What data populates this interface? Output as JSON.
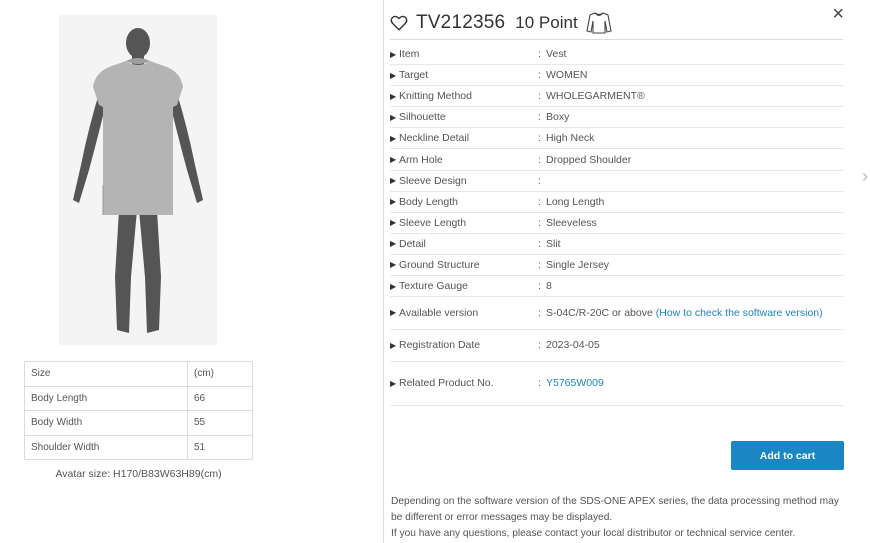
{
  "product": {
    "code": "TV212356",
    "points": "10 Point"
  },
  "specs": [
    {
      "label": "Item",
      "value": "Vest"
    },
    {
      "label": "Target",
      "value": "WOMEN"
    },
    {
      "label": "Knitting Method",
      "value": "WHOLEGARMENT®"
    },
    {
      "label": "Silhouette",
      "value": "Boxy"
    },
    {
      "label": "Neckline Detail",
      "value": "High Neck"
    },
    {
      "label": "Arm Hole",
      "value": "Dropped Shoulder"
    },
    {
      "label": "Sleeve Design",
      "value": ""
    },
    {
      "label": "Body Length",
      "value": "Long Length"
    },
    {
      "label": "Sleeve Length",
      "value": "Sleeveless"
    },
    {
      "label": "Detail",
      "value": "Slit"
    },
    {
      "label": "Ground Structure",
      "value": "Single Jersey"
    },
    {
      "label": "Texture Gauge",
      "value": "8"
    }
  ],
  "available_version": {
    "label": "Available version",
    "value": "S-04C/R-20C or above",
    "link": "(How to check the software version)"
  },
  "registration": {
    "label": "Registration Date",
    "value": "2023-04-05"
  },
  "related": {
    "label": "Related Product No.",
    "value": "Y5765W009"
  },
  "colon": ":",
  "cart_label": "Add to cart",
  "note_lines": [
    "Depending on the software version of the SDS-ONE APEX series, the data processing method may",
    "be different or error messages may be displayed.",
    "If you have any questions, please contact your local distributor or technical service center."
  ],
  "size_table": {
    "header": [
      "Size",
      "(cm)"
    ],
    "rows": [
      [
        "Body Length",
        "66"
      ],
      [
        "Body Width",
        "55"
      ],
      [
        "Shoulder Width",
        "51"
      ]
    ]
  },
  "avatar_size": "Avatar size: H170/B83W63H89(cm)",
  "icons": {
    "close": "×",
    "next": "›",
    "row_marker": "▶"
  }
}
